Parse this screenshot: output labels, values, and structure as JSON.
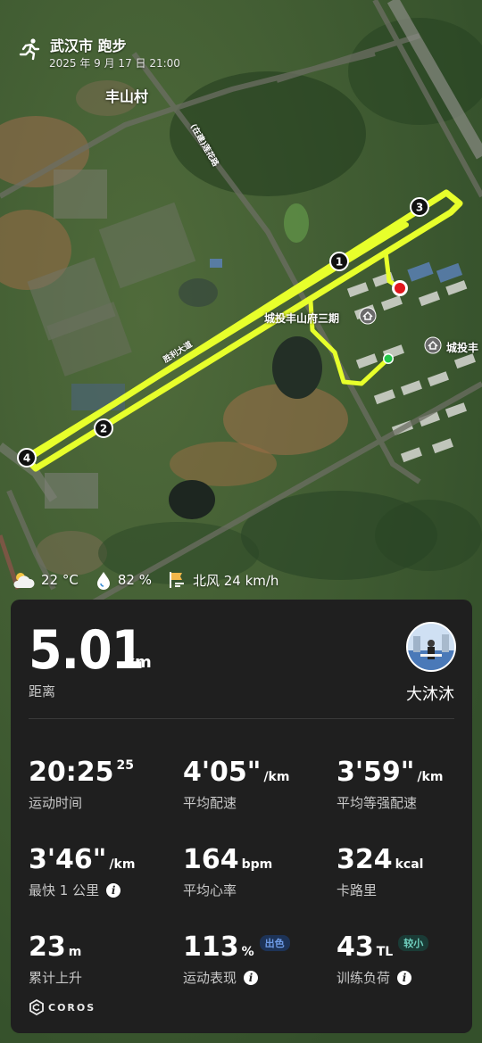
{
  "header": {
    "title": "武汉市 跑步",
    "datetime": "2025 年 9 月 17 日 21:00"
  },
  "map": {
    "labels": {
      "village": "丰山村",
      "road": "(在建)莲花路",
      "road2": "胜利大道",
      "complex1": "城投丰山府三期",
      "complex2": "城投丰"
    },
    "markers": [
      "1",
      "2",
      "3",
      "4"
    ],
    "route_color": "#e7ff2b"
  },
  "weather": {
    "temp": "22 °C",
    "humidity": "82 %",
    "wind": "北风 24 km/h"
  },
  "summary": {
    "distance": "5.01",
    "distance_unit": "km",
    "distance_label": "距离",
    "username": "大沐沐"
  },
  "stats": [
    {
      "value": "20:25",
      "sup": "25",
      "unit": "",
      "label": "运动时间"
    },
    {
      "value": "4'05\"",
      "unit": "/km",
      "label": "平均配速"
    },
    {
      "value": "3'59\"",
      "unit": "/km",
      "label": "平均等强配速"
    },
    {
      "value": "3'46\"",
      "unit": "/km",
      "label": "最快 1 公里"
    },
    {
      "value": "164",
      "unit": "bpm",
      "label": "平均心率"
    },
    {
      "value": "324",
      "unit": "kcal",
      "label": "卡路里"
    },
    {
      "value": "23",
      "unit": "m",
      "label": "累计上升"
    },
    {
      "value": "113",
      "unit": "%",
      "badge": "出色",
      "label": "运动表现"
    },
    {
      "value": "43",
      "unit": "TL",
      "badge": "较小",
      "label": "训练负荷"
    }
  ],
  "brand": "COROS"
}
